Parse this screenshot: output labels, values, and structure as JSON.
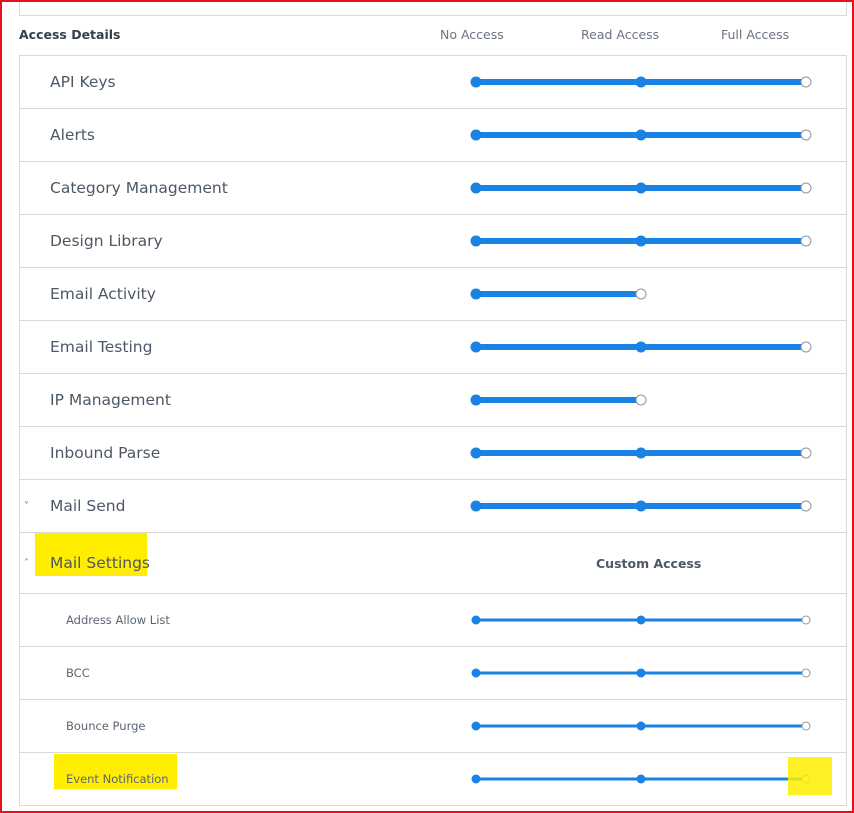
{
  "header": {
    "title": "Access Details",
    "levels": [
      "No Access",
      "Read Access",
      "Full Access"
    ]
  },
  "rows": [
    {
      "label": "API Keys",
      "level": 2
    },
    {
      "label": "Alerts",
      "level": 2
    },
    {
      "label": "Category Management",
      "level": 2
    },
    {
      "label": "Design Library",
      "level": 2
    },
    {
      "label": "Email Activity",
      "level": 1
    },
    {
      "label": "Email Testing",
      "level": 2
    },
    {
      "label": "IP Management",
      "level": 1
    },
    {
      "label": "Inbound Parse",
      "level": 2
    },
    {
      "label": "Mail Send",
      "level": 2,
      "expandable": true,
      "expanded": false
    },
    {
      "label": "Mail Settings",
      "expandable": true,
      "expanded": true,
      "access_text": "Custom Access"
    }
  ],
  "sub_rows": [
    {
      "label": "Address Allow List",
      "level": 2
    },
    {
      "label": "BCC",
      "level": 2
    },
    {
      "label": "Bounce Purge",
      "level": 2
    },
    {
      "label": "Event Notification",
      "level": 2
    }
  ],
  "colors": {
    "accent": "#1a82e2",
    "highlight": "#ffee00",
    "frame": "#e8101a"
  },
  "icons": {
    "collapsed": "chevron-down-icon",
    "expanded": "chevron-up-icon"
  }
}
